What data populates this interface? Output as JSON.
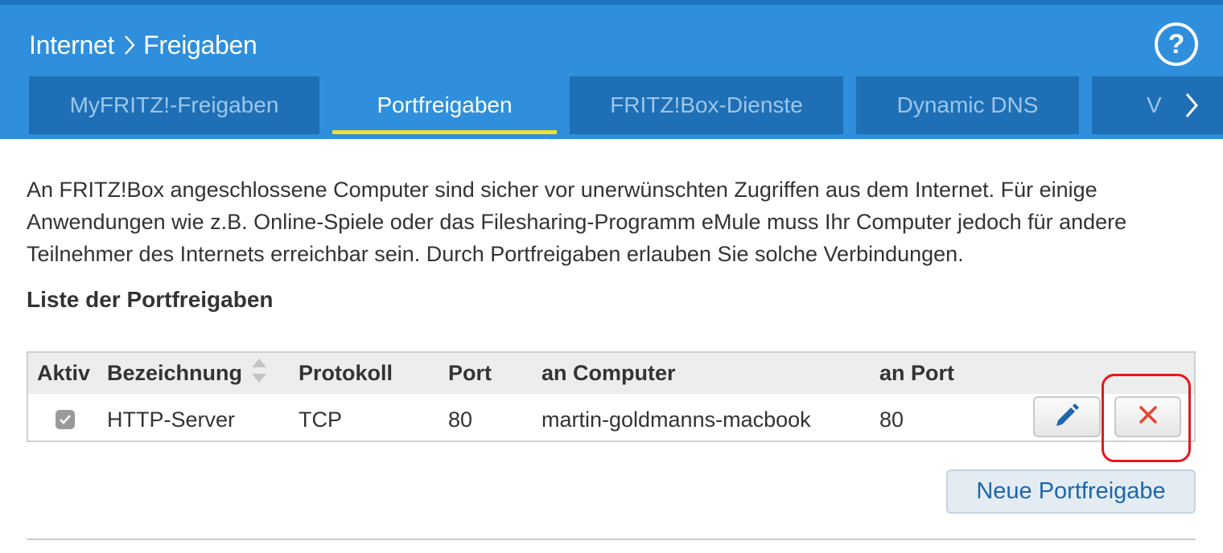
{
  "breadcrumb": {
    "section": "Internet",
    "page": "Freigaben"
  },
  "icons": {
    "help": "help-circle-icon",
    "breadcrumb_separator": "chevron-right-icon",
    "tabs_next": "chevron-right-icon",
    "sort": "sort-updown-icon",
    "checkbox": "checkmark-icon",
    "edit": "pencil-icon",
    "delete": "close-x-icon"
  },
  "help": {
    "label": "?"
  },
  "tabs": [
    {
      "label": "MyFRITZ!-Freigaben",
      "active": false
    },
    {
      "label": "Portfreigaben",
      "active": true
    },
    {
      "label": "FRITZ!Box-Dienste",
      "active": false
    },
    {
      "label": "Dynamic DNS",
      "active": false
    },
    {
      "label": "V",
      "active": false
    }
  ],
  "intro_text": "An FRITZ!Box angeschlossene Computer sind sicher vor unerwünschten Zugriffen aus dem Internet. Für einige Anwendungen wie z.B. Online-Spiele oder das Filesharing-Programm eMule muss Ihr Computer jedoch für andere Teilnehmer des Internets erreichbar sein. Durch Portfreigaben erlauben Sie solche Verbindungen.",
  "list_title": "Liste der Portfreigaben",
  "table": {
    "headers": {
      "active": "Aktiv",
      "name": "Bezeichnung",
      "protocol": "Protokoll",
      "port": "Port",
      "computer": "an Computer",
      "target_port": "an Port"
    },
    "rows": [
      {
        "active": true,
        "name": "HTTP-Server",
        "protocol": "TCP",
        "port": "80",
        "computer": "martin-goldmanns-macbook",
        "target_port": "80"
      }
    ]
  },
  "new_button_label": "Neue Portfreigabe",
  "colors": {
    "header_blue": "#2f8fdc",
    "tab_blue": "#1e6fb5",
    "tab_active_underline": "#f2e12d",
    "delete_red": "#e8432f",
    "edit_blue": "#1d66ad",
    "highlight_red": "#e8161b"
  }
}
